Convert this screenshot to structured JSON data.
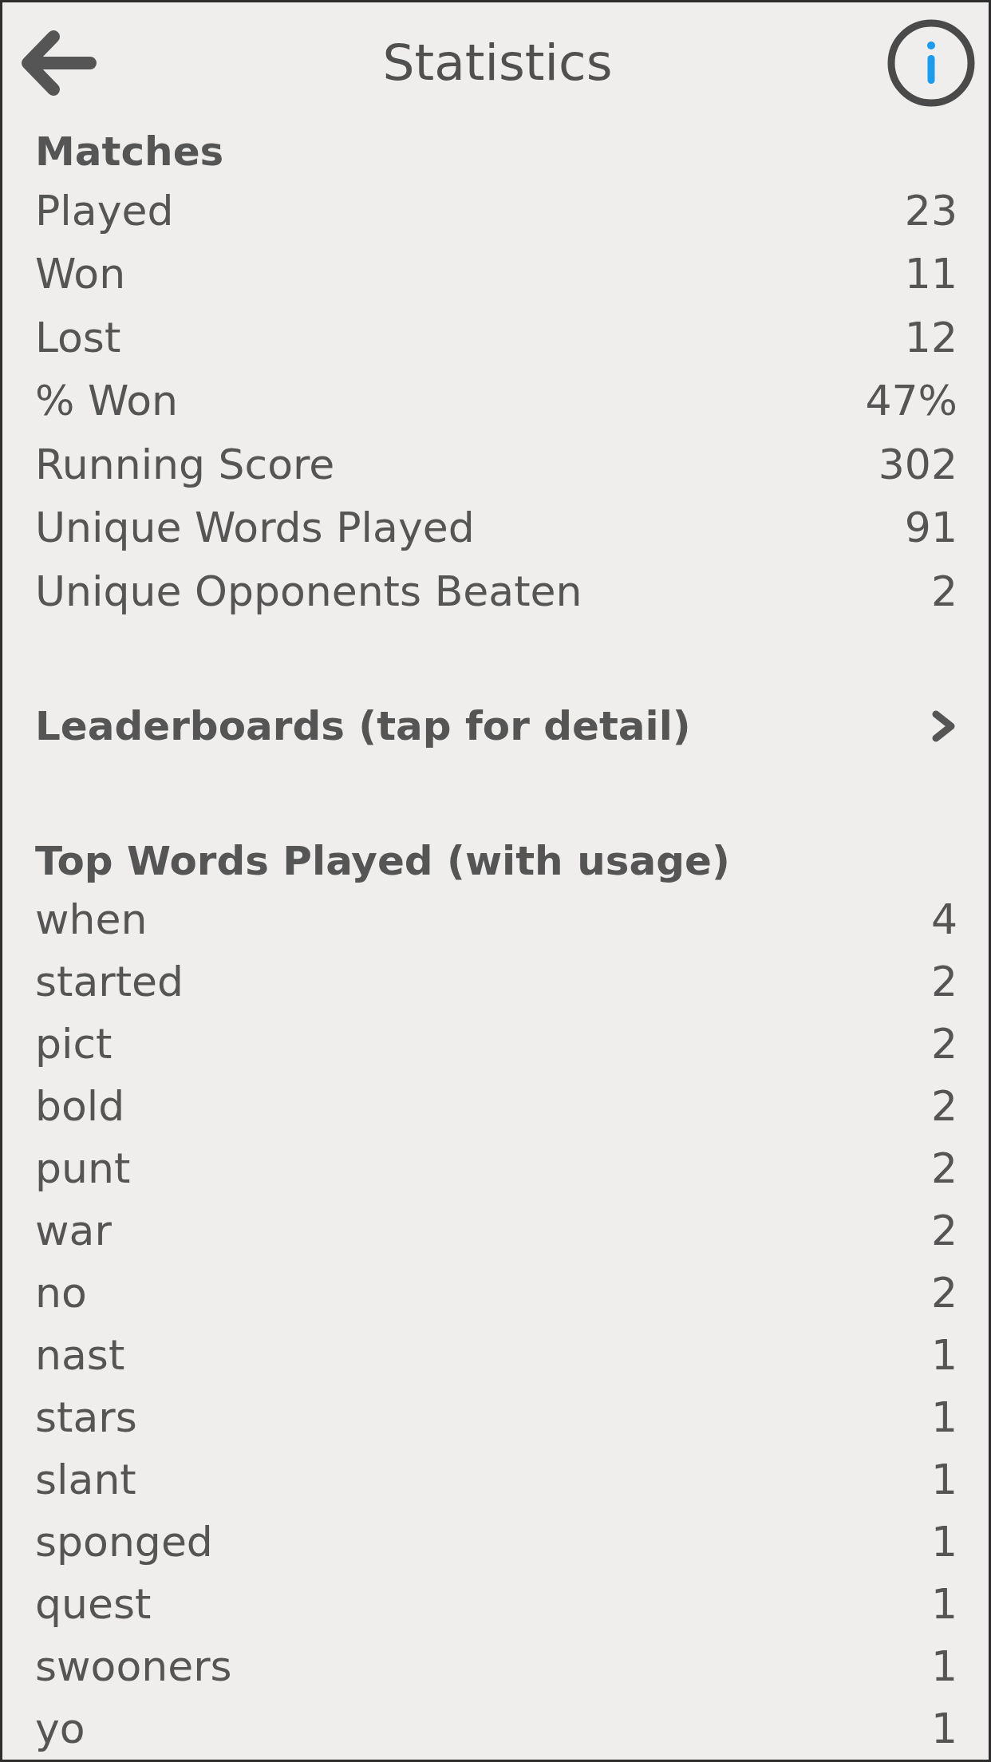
{
  "header": {
    "title": "Statistics"
  },
  "matches": {
    "heading": "Matches",
    "rows": [
      {
        "label": "Played",
        "value": "23"
      },
      {
        "label": "Won",
        "value": "11"
      },
      {
        "label": "Lost",
        "value": "12"
      },
      {
        "label": "% Won",
        "value": "47%"
      },
      {
        "label": "Running Score",
        "value": "302"
      },
      {
        "label": "Unique Words Played",
        "value": "91"
      },
      {
        "label": "Unique Opponents Beaten",
        "value": "2"
      }
    ]
  },
  "leaderboards": {
    "label": "Leaderboards (tap for detail)"
  },
  "top_words": {
    "heading": "Top Words Played (with usage)",
    "rows": [
      {
        "word": "when",
        "count": "4"
      },
      {
        "word": "started",
        "count": "2"
      },
      {
        "word": "pict",
        "count": "2"
      },
      {
        "word": "bold",
        "count": "2"
      },
      {
        "word": "punt",
        "count": "2"
      },
      {
        "word": "war",
        "count": "2"
      },
      {
        "word": "no",
        "count": "2"
      },
      {
        "word": "nast",
        "count": "1"
      },
      {
        "word": "stars",
        "count": "1"
      },
      {
        "word": "slant",
        "count": "1"
      },
      {
        "word": "sponged",
        "count": "1"
      },
      {
        "word": "quest",
        "count": "1"
      },
      {
        "word": "swooners",
        "count": "1"
      },
      {
        "word": "yo",
        "count": "1"
      }
    ]
  }
}
